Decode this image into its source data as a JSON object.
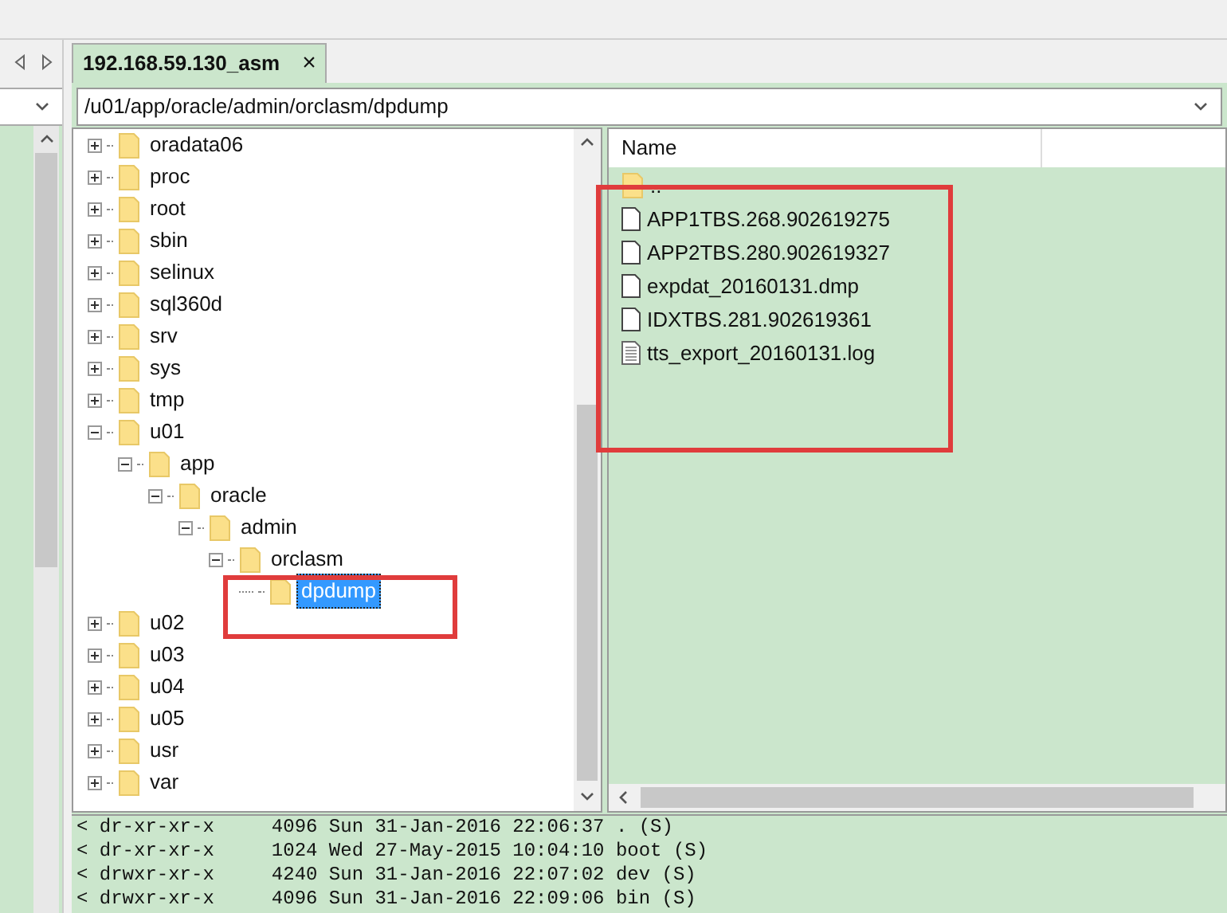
{
  "tab": {
    "label": "192.168.59.130_asm",
    "selected": true,
    "close": "×"
  },
  "path": {
    "value": "/u01/app/oracle/admin/orclasm/dpdump"
  },
  "tree": [
    {
      "name": "oradata06",
      "kind": "collapsed",
      "selected": false
    },
    {
      "name": "proc",
      "kind": "collapsed",
      "selected": false
    },
    {
      "name": "root",
      "kind": "collapsed",
      "selected": false
    },
    {
      "name": "sbin",
      "kind": "collapsed",
      "selected": false
    },
    {
      "name": "selinux",
      "kind": "collapsed",
      "selected": false
    },
    {
      "name": "sql360d",
      "kind": "collapsed",
      "selected": false
    },
    {
      "name": "srv",
      "kind": "collapsed",
      "selected": false
    },
    {
      "name": "sys",
      "kind": "collapsed",
      "selected": false
    },
    {
      "name": "tmp",
      "kind": "collapsed",
      "selected": false
    },
    {
      "name": "u01",
      "kind": "expanded",
      "selected": false,
      "children": [
        {
          "name": "app",
          "kind": "expanded",
          "selected": false,
          "children": [
            {
              "name": "oracle",
              "kind": "expanded",
              "selected": false,
              "children": [
                {
                  "name": "admin",
                  "kind": "expanded",
                  "selected": false,
                  "children": [
                    {
                      "name": "orclasm",
                      "kind": "expanded",
                      "selected": false,
                      "children": [
                        {
                          "name": "dpdump",
                          "kind": "leaf",
                          "selected": true
                        }
                      ]
                    }
                  ]
                }
              ]
            }
          ]
        }
      ]
    },
    {
      "name": "u02",
      "kind": "collapsed",
      "selected": false
    },
    {
      "name": "u03",
      "kind": "collapsed",
      "selected": false
    },
    {
      "name": "u04",
      "kind": "collapsed",
      "selected": false
    },
    {
      "name": "u05",
      "kind": "collapsed",
      "selected": false
    },
    {
      "name": "usr",
      "kind": "collapsed",
      "selected": false
    },
    {
      "name": "var",
      "kind": "collapsed",
      "selected": false
    }
  ],
  "file_list": {
    "columns": [
      "Name"
    ],
    "rows": [
      {
        "name": "..",
        "kind": "folder"
      },
      {
        "name": "APP1TBS.268.902619275",
        "kind": "file"
      },
      {
        "name": "APP2TBS.280.902619327",
        "kind": "file"
      },
      {
        "name": "expdat_20160131.dmp",
        "kind": "file"
      },
      {
        "name": "IDXTBS.281.902619361",
        "kind": "file"
      },
      {
        "name": "tts_export_20160131.log",
        "kind": "text"
      }
    ]
  },
  "log": [
    "< dr-xr-xr-x     4096 Sun 31-Jan-2016 22:06:37 . (S)",
    "< dr-xr-xr-x     1024 Wed 27-May-2015 10:04:10 boot (S)",
    "< drwxr-xr-x     4240 Sun 31-Jan-2016 22:07:02 dev (S)",
    "< drwxr-xr-x     4096 Sun 31-Jan-2016 22:09:06 bin (S)"
  ]
}
